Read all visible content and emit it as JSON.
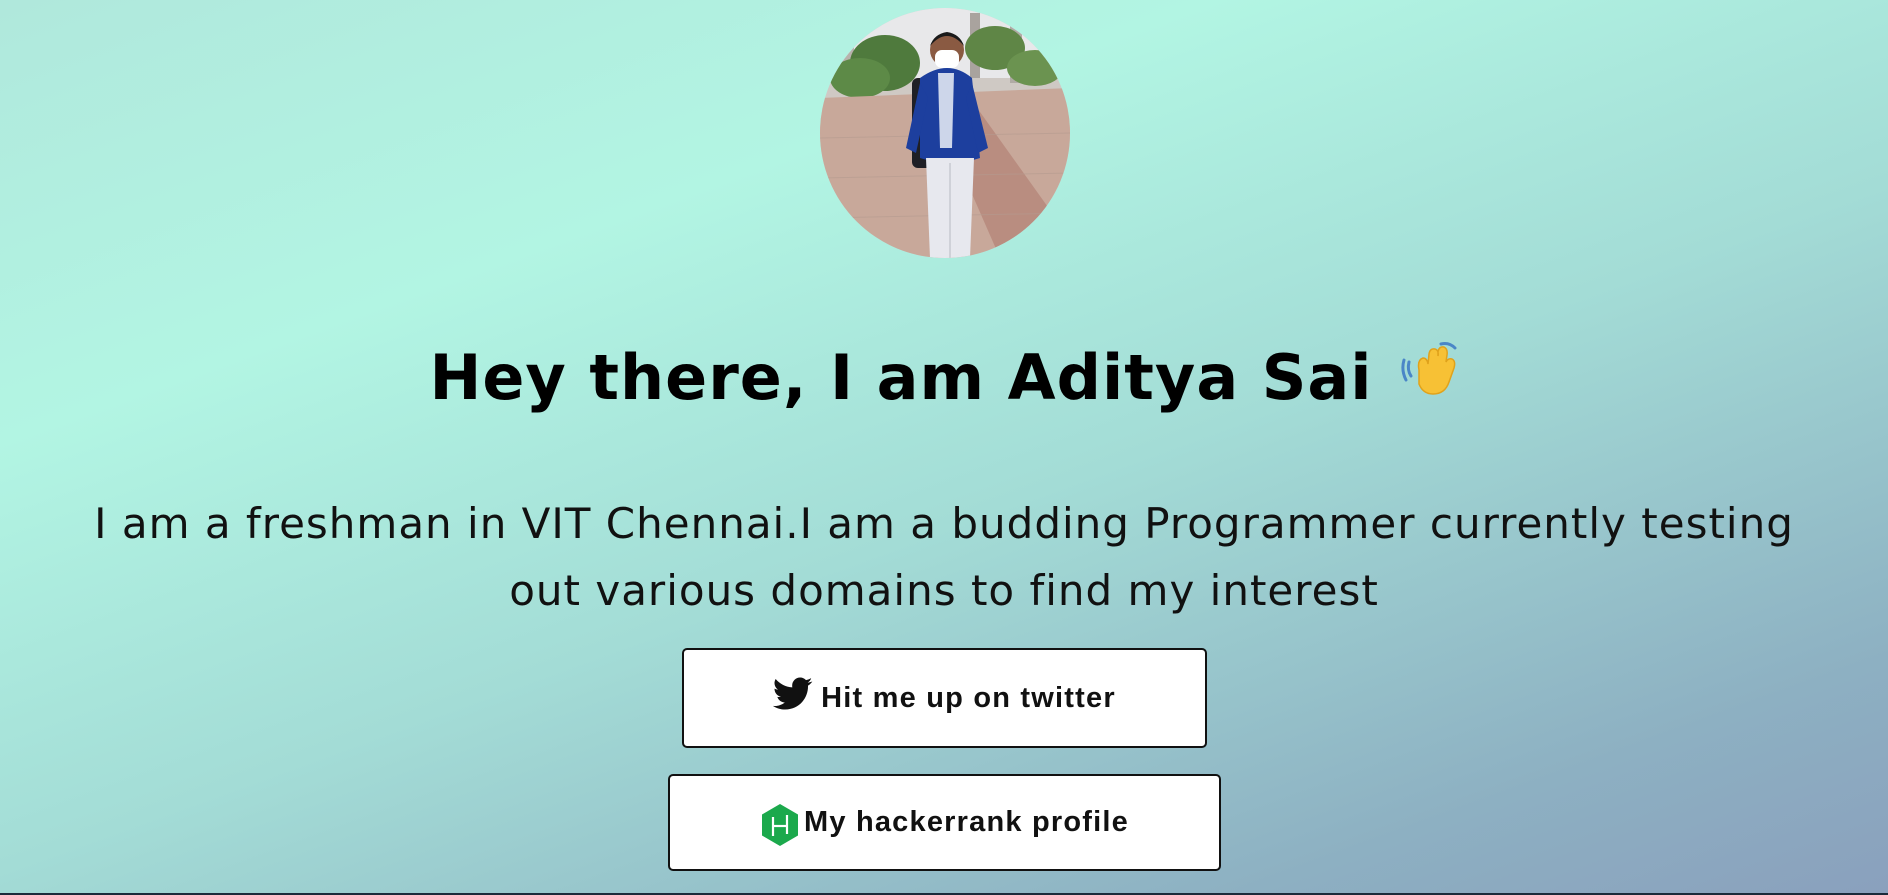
{
  "profile": {
    "avatar_alt": "profile photo"
  },
  "hero": {
    "heading": "Hey there, I am Aditya Sai",
    "wave_icon": "waving-hand-icon"
  },
  "bio": {
    "text": "I am a freshman in VIT Chennai.I am a budding Programmer currently testing out various domains to find my interest"
  },
  "links": {
    "twitter": {
      "label": "Hit me up on twitter",
      "icon": "twitter-bird-icon"
    },
    "hackerrank": {
      "label": "My hackerrank profile",
      "icon": "hackerrank-icon",
      "icon_color": "#1ba94c"
    }
  }
}
